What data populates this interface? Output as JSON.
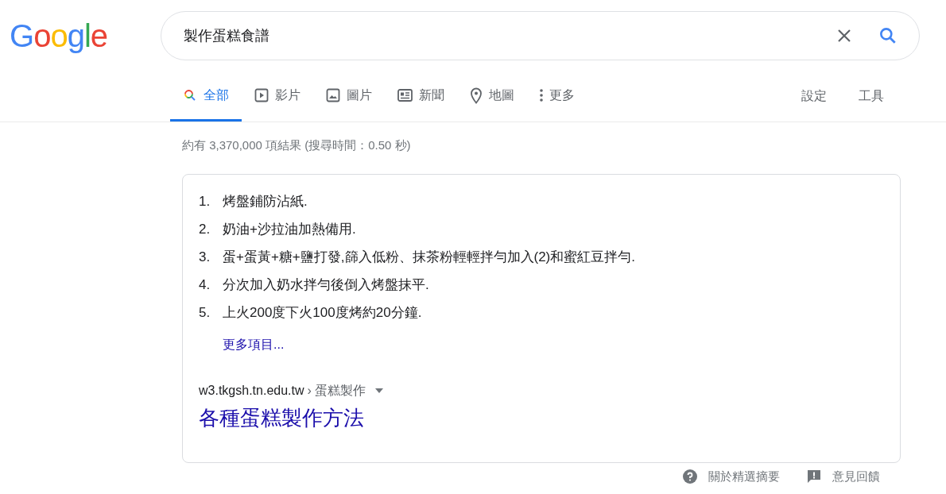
{
  "logo": "Google",
  "search": {
    "value": "製作蛋糕食譜"
  },
  "tabs": [
    {
      "label": "全部",
      "kind": "all",
      "selected": true
    },
    {
      "label": "影片",
      "kind": "video",
      "selected": false
    },
    {
      "label": "圖片",
      "kind": "image",
      "selected": false
    },
    {
      "label": "新聞",
      "kind": "news",
      "selected": false
    },
    {
      "label": "地圖",
      "kind": "map",
      "selected": false
    },
    {
      "label": "更多",
      "kind": "more",
      "selected": false
    }
  ],
  "tools": [
    "設定",
    "工具"
  ],
  "result_stats": "約有 3,370,000 項結果 (搜尋時間：0.50 秒)",
  "snippet": {
    "items": [
      {
        "number": "1.",
        "text": "烤盤鋪防沾紙."
      },
      {
        "number": "2.",
        "text": "奶油+沙拉油加熱備用."
      },
      {
        "number": "3.",
        "text": "蛋+蛋黃+糖+鹽打發,篩入低粉、抹茶粉輕輕拌勻加入(2)和蜜紅豆拌勻."
      },
      {
        "number": "4.",
        "text": "分次加入奶水拌勻後倒入烤盤抹平."
      },
      {
        "number": "5.",
        "text": "上火200度下火100度烤約20分鐘."
      }
    ],
    "more_link": "更多項目...",
    "url": "w3.tkgsh.tn.edu.tw",
    "breadcrumb": "› 蛋糕製作",
    "title": "各種蛋糕製作方法"
  },
  "footer": [
    {
      "label": "關於精選摘要",
      "kind": "help"
    },
    {
      "label": "意見回饋",
      "kind": "feedback"
    }
  ]
}
